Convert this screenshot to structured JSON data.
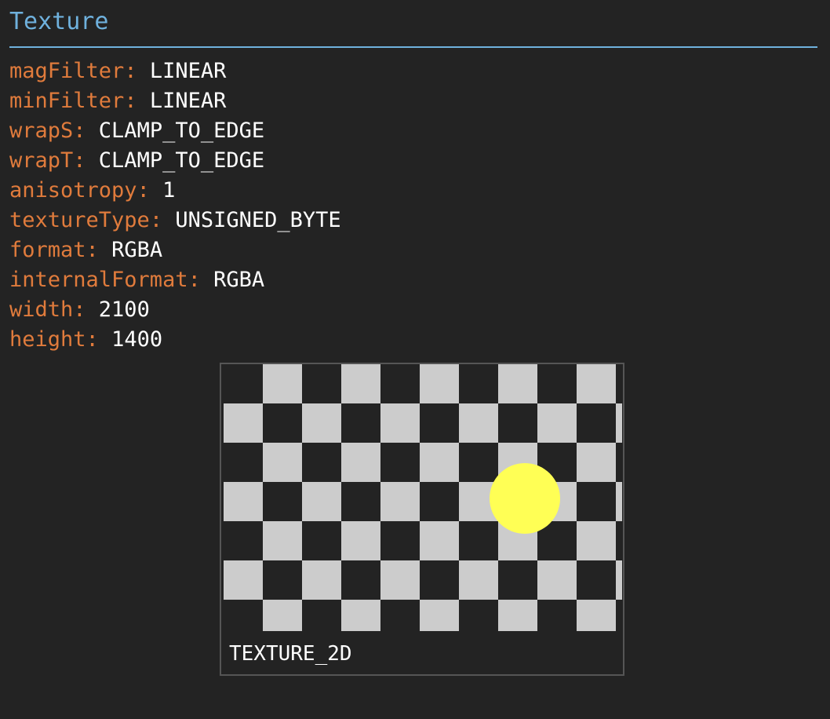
{
  "panel": {
    "title": "Texture"
  },
  "properties": [
    {
      "key": "magFilter",
      "value": "LINEAR"
    },
    {
      "key": "minFilter",
      "value": "LINEAR"
    },
    {
      "key": "wrapS",
      "value": "CLAMP_TO_EDGE"
    },
    {
      "key": "wrapT",
      "value": "CLAMP_TO_EDGE"
    },
    {
      "key": "anisotropy",
      "value": "1"
    },
    {
      "key": "textureType",
      "value": "UNSIGNED_BYTE"
    },
    {
      "key": "format",
      "value": "RGBA"
    },
    {
      "key": "internalFormat",
      "value": "RGBA"
    },
    {
      "key": "width",
      "value": "2100"
    },
    {
      "key": "height",
      "value": "1400"
    }
  ],
  "preview": {
    "target_label": "TEXTURE_2D",
    "checker_light": "#cccccc",
    "checker_dark": "#232323",
    "dot_color": "#ffff55"
  },
  "colors": {
    "title": "#6fb1dd",
    "key": "#e07b3c",
    "value": "#ffffff",
    "background": "#232323"
  }
}
